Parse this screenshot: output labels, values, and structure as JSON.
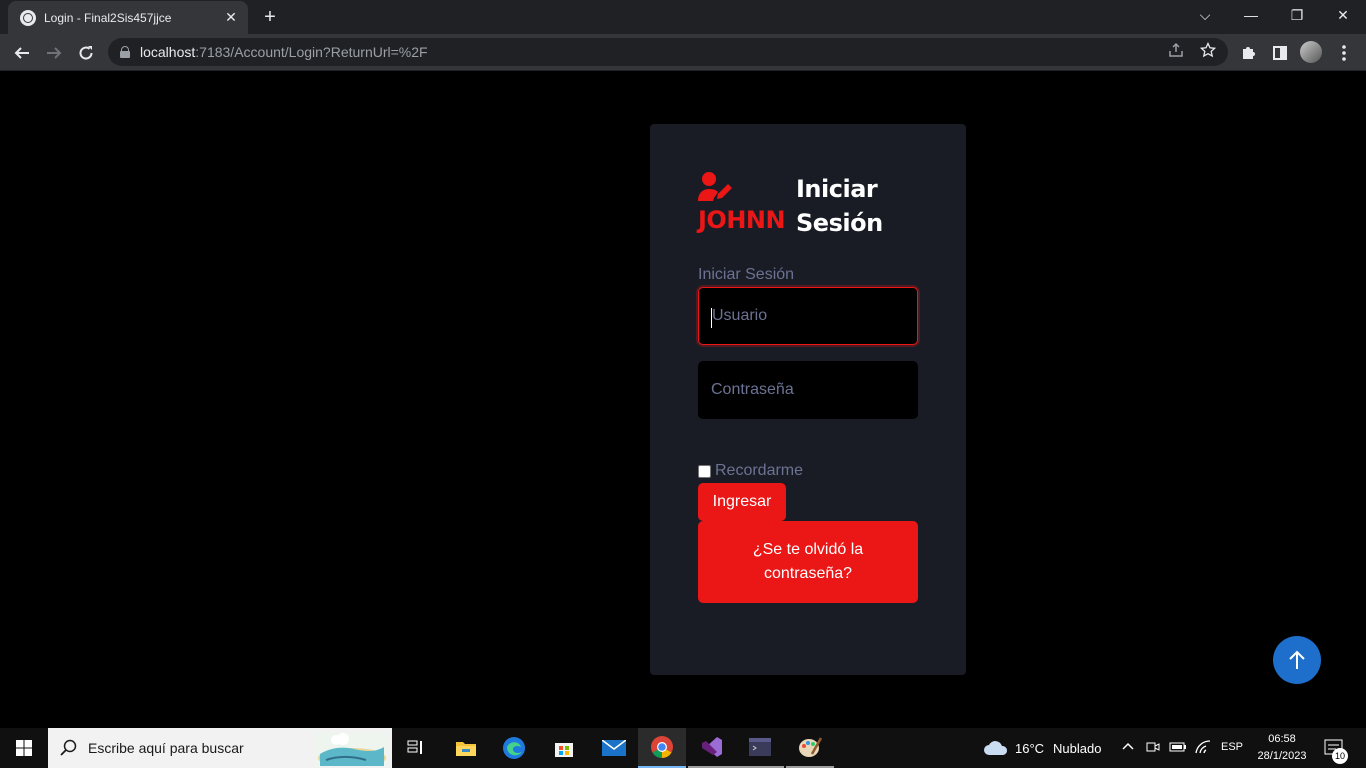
{
  "browser": {
    "tab_title": "Login - Final2Sis457jjce",
    "tab_close": "✕",
    "new_tab": "+",
    "url_host": "localhost",
    "url_path": ":7183/Account/Login?ReturnUrl=%2F",
    "window_controls": {
      "tab_search": "⌵",
      "minimize": "—",
      "restore": "❐",
      "close": "✕"
    }
  },
  "login": {
    "brand_name": "JOHNN",
    "brand_title": "Iniciar Sesión",
    "form_label": "Iniciar Sesión",
    "username_placeholder": "Usuario",
    "password_placeholder": "Contraseña",
    "remember_label": "Recordarme",
    "submit_label": "Ingresar",
    "forgot_label": "¿Se te olvidó la contraseña?",
    "accent_color": "#eb1616",
    "card_color": "#191c24"
  },
  "taskbar": {
    "search_placeholder": "Escribe aquí para buscar",
    "weather_temp": "16°C",
    "weather_text": "Nublado",
    "language": "ESP",
    "time": "06:58",
    "date": "28/1/2023",
    "notification_count": "10",
    "apps": [
      "task-view",
      "file-explorer",
      "edge",
      "microsoft-store",
      "mail",
      "chrome",
      "visual-studio",
      "terminal",
      "paint"
    ]
  }
}
